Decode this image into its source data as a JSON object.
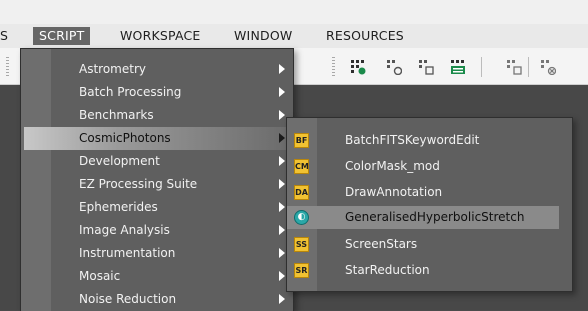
{
  "menubar": {
    "items": [
      {
        "label": "S"
      },
      {
        "label": "SCRIPT"
      },
      {
        "label": "WORKSPACE"
      },
      {
        "label": "WINDOW"
      },
      {
        "label": "RESOURCES"
      }
    ]
  },
  "script_menu": {
    "items": [
      {
        "label": "Astrometry"
      },
      {
        "label": "Batch Processing"
      },
      {
        "label": "Benchmarks"
      },
      {
        "label": "CosmicPhotons"
      },
      {
        "label": "Development"
      },
      {
        "label": "EZ Processing Suite"
      },
      {
        "label": "Ephemerides"
      },
      {
        "label": "Image Analysis"
      },
      {
        "label": "Instrumentation"
      },
      {
        "label": "Mosaic"
      },
      {
        "label": "Noise Reduction"
      }
    ]
  },
  "submenu": {
    "items": [
      {
        "label": "BatchFITSKeywordEdit",
        "badge": "BF",
        "icon": "script-icon"
      },
      {
        "label": "ColorMask_mod",
        "badge": "CM",
        "icon": "script-icon"
      },
      {
        "label": "DrawAnnotation",
        "badge": "DA",
        "icon": "script-icon"
      },
      {
        "label": "GeneralisedHyperbolicStretch",
        "badge": "",
        "icon": "ghs-icon"
      },
      {
        "label": "ScreenStars",
        "badge": "SS",
        "icon": "script-icon"
      },
      {
        "label": "StarReduction",
        "badge": "SR",
        "icon": "script-icon"
      }
    ]
  }
}
